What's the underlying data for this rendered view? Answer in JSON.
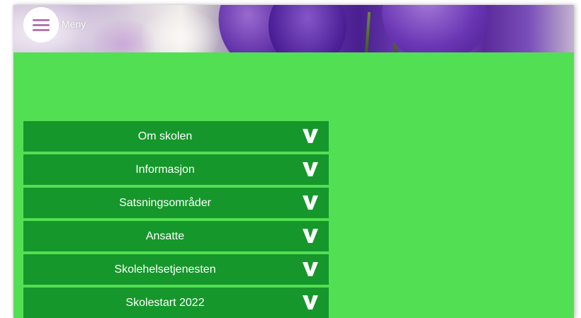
{
  "header": {
    "menu_label": "Meny"
  },
  "colors": {
    "content_background": "#53df53",
    "accordion_item": "#16972b",
    "accordion_text": "#ffffff",
    "menu_icon": "#b477ae"
  },
  "accordion": {
    "items": [
      {
        "label": "Om skolen",
        "icon": "chevron-down-icon"
      },
      {
        "label": "Informasjon",
        "icon": "chevron-down-icon"
      },
      {
        "label": "Satsningsområder",
        "icon": "chevron-down-icon"
      },
      {
        "label": "Ansatte",
        "icon": "chevron-down-icon"
      },
      {
        "label": "Skolehelsetjenesten",
        "icon": "chevron-down-icon"
      },
      {
        "label": "Skolestart 2022",
        "icon": "chevron-down-icon"
      }
    ]
  }
}
